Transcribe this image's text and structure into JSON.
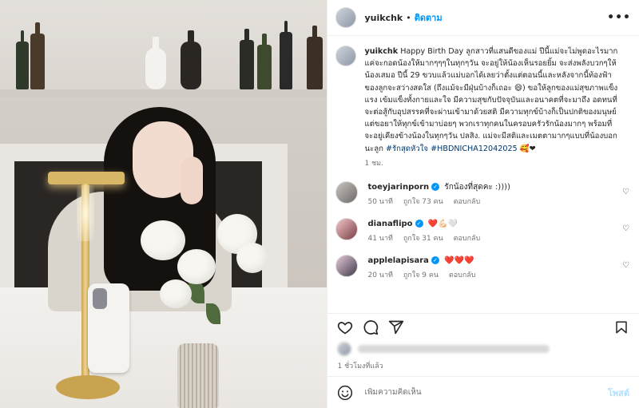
{
  "post": {
    "username": "yuikchk",
    "follow_label": "ติดตาม",
    "more_label": "•••",
    "caption_text": "Happy Birth Day ลูกสาวที่แสนดีของแม่ ปีนี้แม่จะไม่พูดอะไรมาก แค่จะกอดน้องให้มากๆๆๆในทุกๆวัน จะอยู่ให้น้องเห็นรอยยิ้ม จะส่งพลังบวกๆให้น้องเสมอ ปีนี้ 29 ขวบแล้วแม่บอกได้เลยว่าตั้งแต่ตอนนี้และหลังจากนี้ท้องฟ้าของลูกจะสว่างสดใส (ถึงแม้จะมีฝุ่นบ้างก็เถอะ 😄) ขอให้ลูกของแม่สุขภาพแข็งแรง เข้มแข็งทั้งกายและใจ มีความสุขกับปัจจุบันและอนาคตที่จะมาถึง อดทนที่จะต่อสู้กับอุปสรรคที่จะผ่านเข้ามาด้วยสติ มีความทุกข์บ้างก็เป็นปกติของมนุษย์ แต่ขอยาให้ทุกข์เข้ามาบ่อยๆ พวกเราทุกคนในครอบครัวรักน้องมากๆ พร้อมที่จะอยู่เคียงข้างน้องในทุกๆวัน ปลสิง. แม่จะมีสติและเมตตามากๆแบบที่น้องบอก นะลูก",
    "hashtag_1": "#รักสุดหัวใจ",
    "hashtag_2": "#HBDNICHA12042025",
    "caption_emoji": "🥰❤",
    "caption_time": "1 ชม.",
    "date_label": "1 ชั่วโมงที่แล้ว",
    "add_comment_placeholder": "เพิ่มความคิดเห็น",
    "post_button": "โพสต์"
  },
  "comments": [
    {
      "user": "toeyjarinporn",
      "verified": true,
      "text": "รักน้องที่สุดคะ :))))",
      "time": "50 นาที",
      "likes": "ถูกใจ 73 คน",
      "reply": "ตอบกลับ"
    },
    {
      "user": "dianaflipo",
      "verified": true,
      "text": "❤️💪🏻🤍",
      "time": "41 นาที",
      "likes": "ถูกใจ 31 คน",
      "reply": "ตอบกลับ"
    },
    {
      "user": "applelapisara",
      "verified": true,
      "text": "❤️❤️❤️",
      "time": "20 นาที",
      "likes": "ถูกใจ 9 คน",
      "reply": "ตอบกลับ"
    }
  ],
  "icons": {
    "like": "heart-icon",
    "comment": "comment-icon",
    "share": "share-icon",
    "save": "bookmark-icon",
    "emoji": "emoji-icon"
  },
  "colors": {
    "accent": "#0095f6",
    "verified": "#0095f6",
    "post_button_disabled": "#b2dffc"
  }
}
